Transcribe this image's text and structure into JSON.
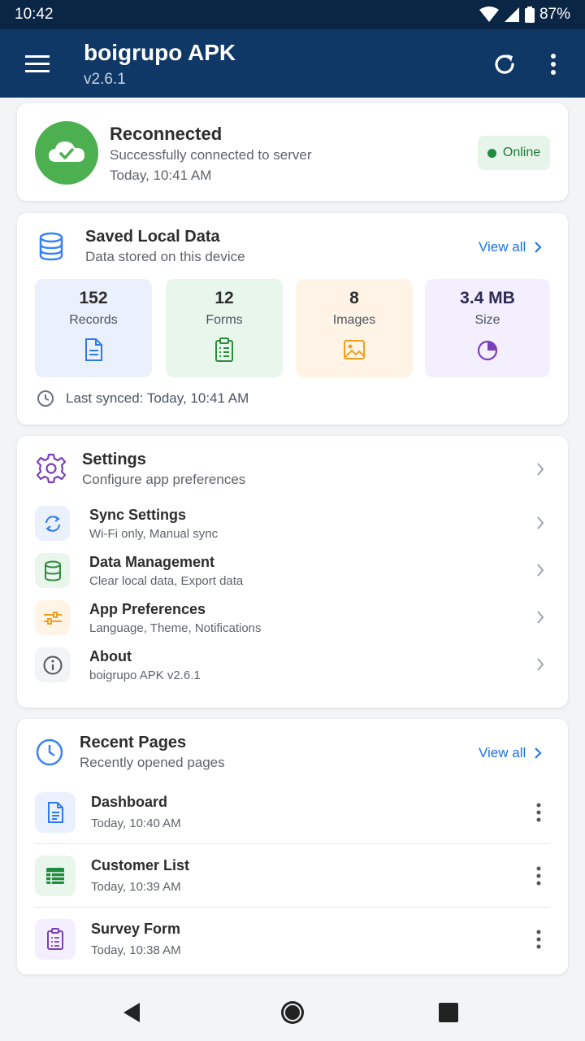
{
  "status_bar": {
    "time": "10:42",
    "battery": "87%"
  },
  "app_bar": {
    "title": "boigrupo APK",
    "version": "v2.6.1"
  },
  "connection": {
    "title": "Reconnected",
    "subtitle": "Successfully connected to server",
    "time": "Today, 10:41 AM",
    "badge": "Online",
    "colors": {
      "success": "#4caf50",
      "badge_bg": "#e6f4ea"
    }
  },
  "saved_data": {
    "title": "Saved Local Data",
    "subtitle": "Data stored on this device",
    "view_all": "View all",
    "tiles": [
      {
        "value": "152",
        "label": "Records",
        "icon": "document-icon",
        "bg": "#eaf1fd",
        "color": "#2f7be5"
      },
      {
        "value": "12",
        "label": "Forms",
        "icon": "clipboard-icon",
        "bg": "#e9f6ec",
        "color": "#2e8b3e"
      },
      {
        "value": "8",
        "label": "Images",
        "icon": "image-icon",
        "bg": "#fff4e6",
        "color": "#f0a020"
      },
      {
        "value": "3.4 MB",
        "label": "Size",
        "icon": "pie-chart-icon",
        "bg": "#f4efff",
        "color": "#7b3fb8"
      }
    ],
    "last_synced": "Last synced: Today, 10:41 AM"
  },
  "settings": {
    "title": "Settings",
    "subtitle": "Configure app preferences",
    "items": [
      {
        "title": "Sync Settings",
        "subtitle": "Wi-Fi only, Manual sync",
        "icon": "sync-icon"
      },
      {
        "title": "Data Management",
        "subtitle": "Clear local data, Export data",
        "icon": "database-icon"
      },
      {
        "title": "App Preferences",
        "subtitle": "Language, Theme, Notifications",
        "icon": "sliders-icon"
      },
      {
        "title": "About",
        "subtitle": "boigrupo APK v2.6.1",
        "icon": "info-icon"
      }
    ]
  },
  "recent": {
    "title": "Recent Pages",
    "subtitle": "Recently opened pages",
    "view_all": "View all",
    "items": [
      {
        "title": "Dashboard",
        "time": "Today, 10:40 AM",
        "icon": "document-icon"
      },
      {
        "title": "Customer List",
        "time": "Today, 10:39 AM",
        "icon": "table-icon"
      },
      {
        "title": "Survey Form",
        "time": "Today, 10:38 AM",
        "icon": "clipboard-icon"
      }
    ]
  }
}
